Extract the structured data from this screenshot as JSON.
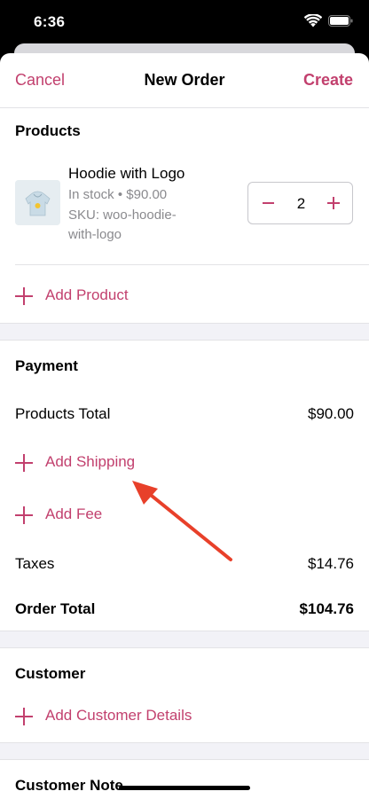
{
  "status_bar": {
    "time": "6:36"
  },
  "nav": {
    "cancel": "Cancel",
    "title": "New Order",
    "create": "Create"
  },
  "products": {
    "title": "Products",
    "items": [
      {
        "name": "Hoodie with Logo",
        "stock_price": "In stock • $90.00",
        "sku_line1": "SKU: woo-hoodie-",
        "sku_line2": "with-logo",
        "quantity": "2"
      }
    ],
    "add_label": "Add Product"
  },
  "payment": {
    "title": "Payment",
    "products_total_label": "Products Total",
    "products_total_value": "$90.00",
    "add_shipping_label": "Add Shipping",
    "add_fee_label": "Add Fee",
    "taxes_label": "Taxes",
    "taxes_value": "$14.76",
    "order_total_label": "Order Total",
    "order_total_value": "$104.76"
  },
  "customer": {
    "title": "Customer",
    "add_label": "Add Customer Details"
  },
  "customer_note": {
    "title": "Customer Note"
  },
  "colors": {
    "accent": "#c2406e",
    "annotation_arrow": "#e8402a",
    "separator_bg": "#f2f2f7"
  },
  "icons": [
    "wifi-icon",
    "battery-icon",
    "minus-icon",
    "plus-icon",
    "hoodie-thumbnail"
  ]
}
